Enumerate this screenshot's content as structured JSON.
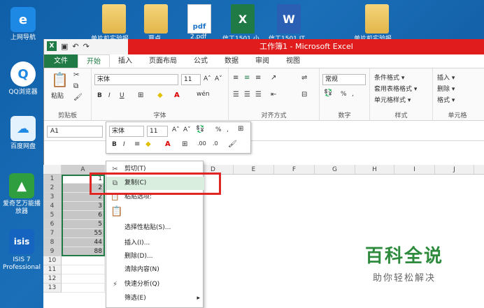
{
  "desktop": {
    "left_icons": [
      {
        "label": "上网导航",
        "icon": "ie-icon"
      },
      {
        "label": "QQ浏览器",
        "icon": "qq-browser-icon"
      },
      {
        "label": "百度网盘",
        "icon": "baidu-netdisk-icon"
      },
      {
        "label": "爱奇艺万能播放器",
        "icon": "iqiyi-player-icon"
      },
      {
        "label": "ISIS 7 Professional",
        "icon": "isis-icon"
      }
    ],
    "top_icons": [
      {
        "label": "单片机实验报",
        "type": "folder"
      },
      {
        "label": "覃貞",
        "type": "folder"
      },
      {
        "label": "2.pdf",
        "type": "pdf"
      },
      {
        "label": "信工1501 小",
        "type": "excel"
      },
      {
        "label": "信工1501 IT",
        "type": "word"
      },
      {
        "label": "单片机实验报",
        "type": "folder"
      }
    ],
    "pdf_text": "pdf",
    "xl_letter": "X",
    "wd_letter": "W",
    "isis_text": "isis"
  },
  "excel": {
    "window_title": "工作簿1 - Microsoft Excel",
    "qat_logo": "X",
    "tabs": [
      "文件",
      "开始",
      "插入",
      "页面布局",
      "公式",
      "数据",
      "审阅",
      "视图"
    ],
    "active_tab": "开始",
    "ribbon": {
      "clipboard": {
        "paste": "粘贴",
        "label": "剪贴板"
      },
      "font": {
        "name": "宋体",
        "size": "11",
        "bold": "B",
        "italic": "I",
        "underline": "U",
        "grow": "A˄",
        "shrink": "A˅",
        "label": "字体",
        "wen": "wén"
      },
      "alignment": {
        "label": "对齐方式"
      },
      "number": {
        "format": "常规",
        "percent": "%",
        "comma": ",",
        "label": "数字"
      },
      "styles": {
        "cond": "条件格式 ▾",
        "table": "套用表格格式 ▾",
        "cell": "单元格样式 ▾",
        "label": "样式"
      },
      "cells": {
        "insert": "插入 ▾",
        "delete": "删除 ▾",
        "format": "格式 ▾",
        "label": "单元格"
      }
    },
    "name_box": "A1",
    "columns": [
      "A",
      "B",
      "C",
      "D",
      "E",
      "F",
      "G",
      "H",
      "I",
      "J",
      "K"
    ],
    "rows": [
      "1",
      "2",
      "3",
      "4",
      "5",
      "6",
      "7",
      "8",
      "9",
      "10",
      "11",
      "12",
      "13"
    ],
    "colA_values": [
      "1",
      "2",
      "2",
      "3",
      "6",
      "5",
      "55",
      "44",
      "88"
    ],
    "mini_toolbar": {
      "font": "宋体",
      "size": "11",
      "bold": "B",
      "italic": "I",
      "grow": "A˄",
      "shrink": "A˅",
      "percent": "%",
      "comma": ","
    },
    "context_menu": [
      {
        "label": "剪切(T)",
        "icon": "scissors-icon"
      },
      {
        "label": "复制(C)",
        "icon": "copy-icon"
      },
      {
        "label": "粘贴选项:",
        "icon": "clipboard-icon"
      },
      {
        "label": "",
        "icon": "paste-icon"
      },
      {
        "label": "选择性粘贴(S)...",
        "icon": ""
      },
      {
        "label": "插入(I)...",
        "icon": ""
      },
      {
        "label": "删除(D)...",
        "icon": ""
      },
      {
        "label": "清除内容(N)",
        "icon": ""
      },
      {
        "label": "快速分析(Q)",
        "icon": "quick-analysis-icon"
      },
      {
        "label": "筛选(E)",
        "icon": ""
      }
    ],
    "highlighted_menu": "复制(C)"
  },
  "watermark": {
    "title": "百科全说",
    "subtitle": "助你轻松解决"
  },
  "colors": {
    "excel_green": "#1f7a45",
    "title_red": "#e01c1c",
    "highlight_box": "#e02525"
  }
}
